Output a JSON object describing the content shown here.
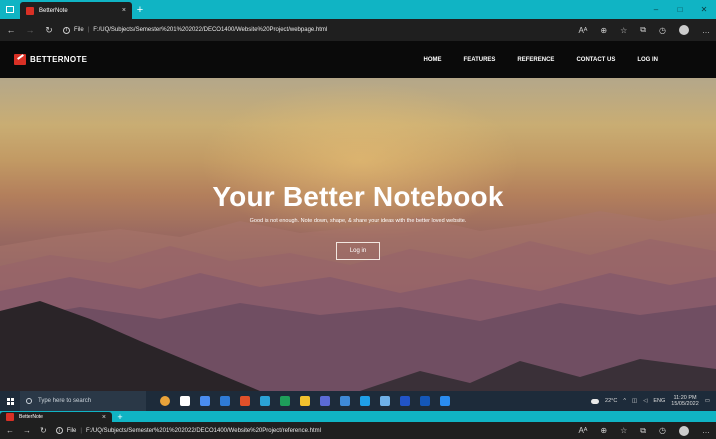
{
  "browser": {
    "tab_title": "BetterNote",
    "tab_close": "×",
    "new_tab": "+",
    "file_label": "File",
    "url": "F:/UQ/Subjects/Semester%201%202022/DECO1400/Website%20Project/webpage.html",
    "win_min": "–",
    "win_max": "□",
    "win_close": "✕"
  },
  "site": {
    "brand": "BETTERNOTE",
    "nav": [
      "HOME",
      "FEATURES",
      "REFERENCE",
      "CONTACT US",
      "LOG IN"
    ],
    "hero_title": "Your Better Notebook",
    "hero_subtitle": "Good is not enough. Note down, shape, & share your ideas with the better loved website.",
    "cta_label": "Log in"
  },
  "taskbar": {
    "search_placeholder": "Type here to search",
    "temperature": "22°C",
    "language": "ENG",
    "time": "11:20 PM",
    "date": "15/05/2022",
    "app_colors": [
      "#e8a33a",
      "#ffffff",
      "#4a8df0",
      "#2f7bd6",
      "#e0502a",
      "#2ba3d6",
      "#1e9e5a",
      "#f2c12e",
      "#5b6bd6",
      "#3f8ad8",
      "#1fa0e8",
      "#6fb1e8",
      "#2154c8",
      "#1457b8",
      "#2a8cf0"
    ]
  },
  "browser2": {
    "tab_title": "BetterNote",
    "tab_close": "×",
    "new_tab": "+",
    "file_label": "File",
    "url": "F:/UQ/Subjects/Semester%201%202022/DECO1400/Website%20Project/reference.html"
  }
}
